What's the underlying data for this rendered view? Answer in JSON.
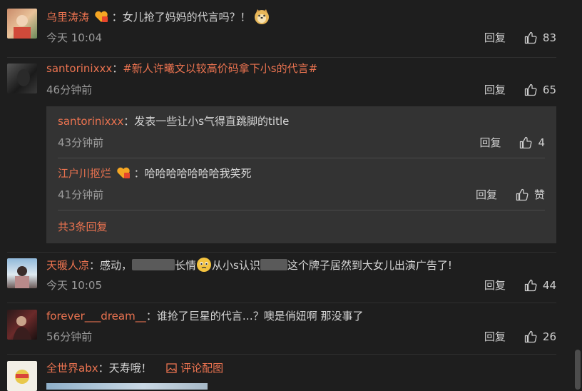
{
  "comments": [
    {
      "user": "乌里涛涛",
      "text": "：女儿抢了妈妈的代言吗？！",
      "time": "今天 10:04",
      "reply": "回复",
      "likes": "83"
    },
    {
      "user": "santorinixxx",
      "text": "：",
      "hashtag": "#新人许曦文以较高价码拿下小s的代言#",
      "time": "46分钟前",
      "reply": "回复",
      "likes": "65",
      "subreplies": [
        {
          "user": "santorinixxx",
          "text": "：发表一些让小s气得直跳脚的title",
          "time": "43分钟前",
          "reply": "回复",
          "likes": "4"
        },
        {
          "user": "江户川抠烂",
          "text": "：哈哈哈哈哈哈哈我笑死",
          "time": "41分钟前",
          "reply": "回复",
          "likes": "赞"
        }
      ],
      "more_replies": "共3条回复"
    },
    {
      "user": "天暖人凉",
      "text_a": "：感动，",
      "text_b": "长情",
      "text_c": "从小s认识",
      "text_d": "这个牌子居然到大女儿出演广告了!",
      "time": "今天 10:05",
      "reply": "回复",
      "likes": "44"
    },
    {
      "user": "forever___dream__",
      "text": "：谁抢了巨星的代言…？噢是俏妞啊 那没事了",
      "time": "56分钟前",
      "reply": "回复",
      "likes": "26"
    },
    {
      "user": "全世界abx",
      "text": "：天寿哦！",
      "image_link": "评论配图"
    }
  ],
  "colors": {
    "background": "#1e1e1e",
    "username": "#eb7350",
    "reply_box": "#333333",
    "muted": "#9a9a9a"
  },
  "icons": {
    "like": "thumbs-up-icon",
    "badge": "vip-badge-icon",
    "image": "image-icon"
  }
}
